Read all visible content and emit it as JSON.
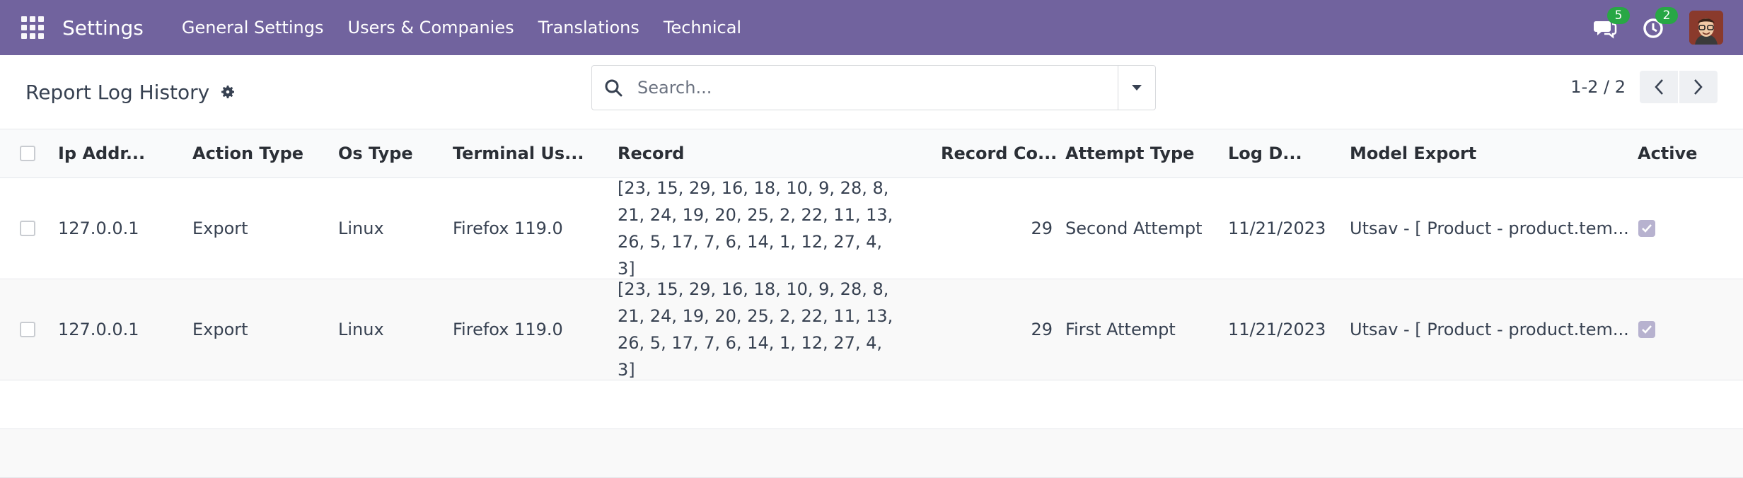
{
  "navbar": {
    "brand": "Settings",
    "menu": [
      "General Settings",
      "Users & Companies",
      "Translations",
      "Technical"
    ],
    "messages_count": "5",
    "activities_count": "2",
    "accent": "#71639e"
  },
  "control": {
    "title": "Report Log History",
    "search_placeholder": "Search...",
    "pager": "1-2 / 2"
  },
  "table": {
    "columns": [
      "Ip Addr...",
      "Action Type",
      "Os Type",
      "Terminal Us...",
      "Record",
      "Record Co...",
      "Attempt Type",
      "Log D...",
      "Model Export",
      "Active"
    ],
    "rows": [
      {
        "ip": "127.0.0.1",
        "action": "Export",
        "os": "Linux",
        "terminal": "Firefox 119.0",
        "record": "[23, 15, 29, 16, 18, 10, 9, 28, 8, 21, 24, 19, 20, 25, 2, 22, 11, 13, 26, 5, 17, 7, 6, 14, 1, 12, 27, 4, 3]",
        "count": "29",
        "attempt": "Second Attempt",
        "date": "11/21/2023",
        "model": "Utsav - [ Product - product.tem...",
        "active": true
      },
      {
        "ip": "127.0.0.1",
        "action": "Export",
        "os": "Linux",
        "terminal": "Firefox 119.0",
        "record": "[23, 15, 29, 16, 18, 10, 9, 28, 8, 21, 24, 19, 20, 25, 2, 22, 11, 13, 26, 5, 17, 7, 6, 14, 1, 12, 27, 4, 3]",
        "count": "29",
        "attempt": "First Attempt",
        "date": "11/21/2023",
        "model": "Utsav - [ Product - product.tem...",
        "active": true
      }
    ]
  }
}
